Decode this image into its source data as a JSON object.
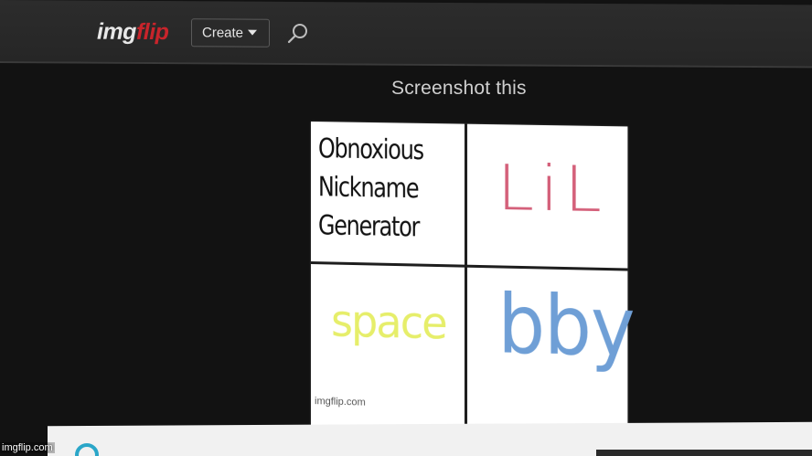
{
  "nav": {
    "logo_img": "img",
    "logo_flip": "flip",
    "create_label": "Create"
  },
  "main": {
    "instruction": "Screenshot this"
  },
  "meme": {
    "title_lines": [
      "Obnoxious",
      "Nickname",
      "Generator"
    ],
    "top_right": "LiL",
    "bottom_left": "space",
    "bottom_right": "bby",
    "inner_watermark": "imgflip.com"
  },
  "watermark": "imgflip.com",
  "colors": {
    "brand_red": "#c8242b",
    "lil": "#d4607a",
    "space": "#e6ee6a",
    "bby": "#6f9fd6",
    "navbar": "#2a2a2a",
    "background": "#121212"
  },
  "icons": [
    "search-icon",
    "caret-down-icon"
  ]
}
